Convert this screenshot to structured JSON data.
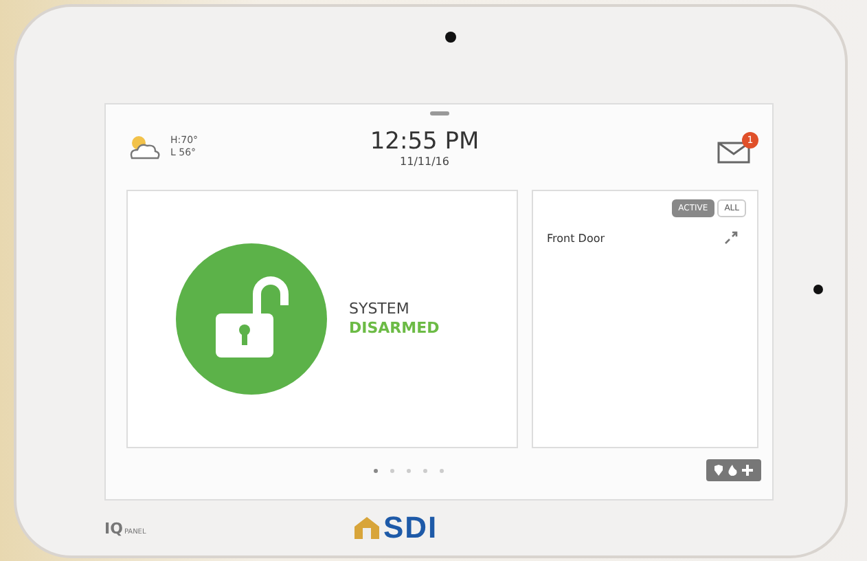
{
  "weather": {
    "high": "H:70°",
    "low": "L 56°"
  },
  "clock": {
    "time": "12:55 PM",
    "date": "11/11/16"
  },
  "messages": {
    "badge": "1"
  },
  "security": {
    "title": "SYSTEM",
    "state": "DISARMED",
    "armed": false
  },
  "sensor_tabs": [
    {
      "label": "ACTIVE",
      "selected": true
    },
    {
      "label": "ALL",
      "selected": false
    }
  ],
  "sensors": [
    {
      "name": "Front Door"
    }
  ],
  "pages": [
    {
      "selected": true
    },
    {
      "selected": false
    },
    {
      "selected": false
    },
    {
      "selected": false
    },
    {
      "selected": false
    }
  ],
  "brand": {
    "logo": "IQ",
    "sub": "PANEL",
    "dealer": "SDI"
  }
}
